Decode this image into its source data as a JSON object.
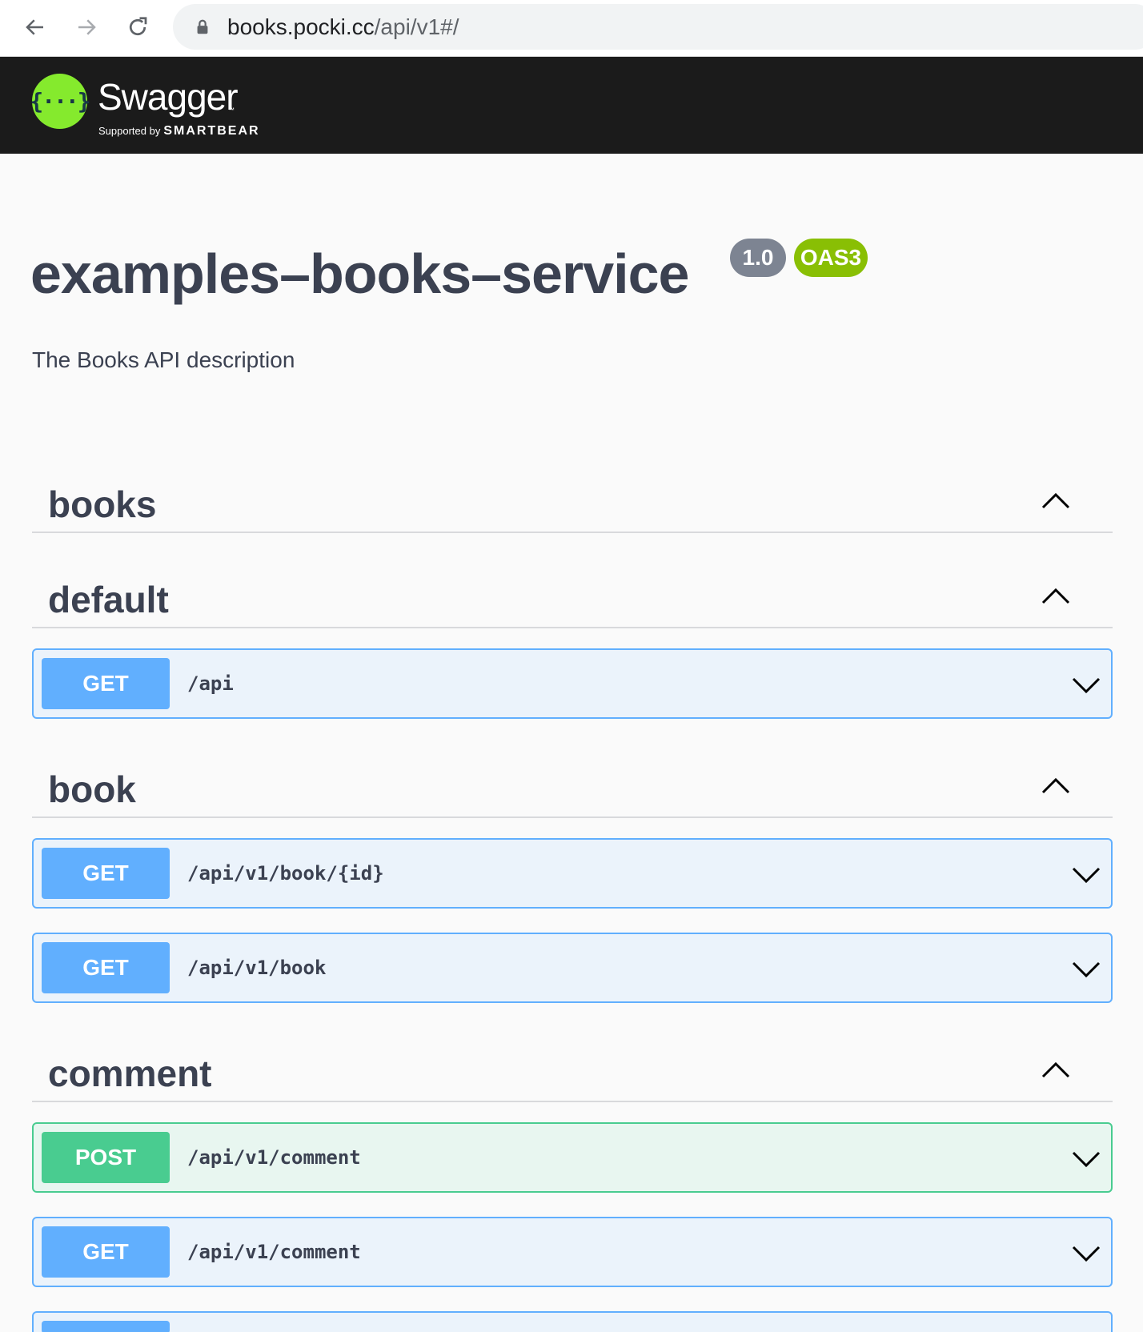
{
  "browser": {
    "url_host": "books.pocki.cc",
    "url_path": "/api/v1#/"
  },
  "topbar": {
    "brand": "Swagger",
    "tm": "™",
    "supported_by": "Supported by",
    "smartbear": "SMARTBEAR",
    "logo_glyph": "{···}"
  },
  "info": {
    "title": "examples–books–service",
    "version": "1.0",
    "oas": "OAS3",
    "description": "The Books API description"
  },
  "colors": {
    "get": "#61affe",
    "post": "#49cc90",
    "topbar": "#1b1b1b",
    "logo": "#85ea2d"
  },
  "tags": [
    {
      "name": "books",
      "operations": []
    },
    {
      "name": "default",
      "operations": [
        {
          "method": "GET",
          "path": "/api"
        }
      ]
    },
    {
      "name": "book",
      "operations": [
        {
          "method": "GET",
          "path": "/api/v1/book/{id}"
        },
        {
          "method": "GET",
          "path": "/api/v1/book"
        }
      ]
    },
    {
      "name": "comment",
      "operations": [
        {
          "method": "POST",
          "path": "/api/v1/comment"
        },
        {
          "method": "GET",
          "path": "/api/v1/comment"
        }
      ]
    }
  ]
}
